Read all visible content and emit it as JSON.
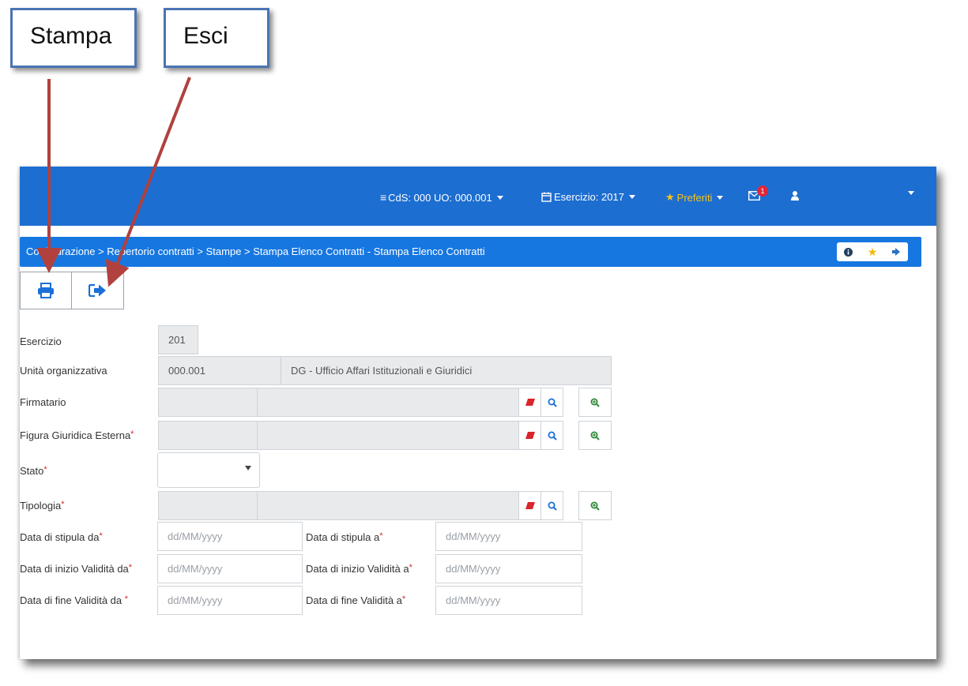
{
  "callouts": {
    "stampa": "Stampa",
    "esci": "Esci"
  },
  "topbar": {
    "cds": "CdS: 000 UO: 000.001",
    "esercizio": "Esercizio: 2017",
    "preferiti": "Preferiti",
    "mail_badge": "1"
  },
  "breadcrumb": "Configurazione > Repertorio contratti > Stampe > Stampa Elenco Contratti - Stampa Elenco Contratti",
  "form": {
    "esercizio": {
      "label": "Esercizio",
      "value": "201"
    },
    "unita": {
      "label": "Unità organizzativa",
      "code": "000.001",
      "description": "DG - Ufficio Affari Istituzionali e Giuridici"
    },
    "firmatario": {
      "label": "Firmatario"
    },
    "figura": {
      "label": "Figura Giuridica Esterna"
    },
    "stato": {
      "label": "Stato"
    },
    "tipologia": {
      "label": "Tipologia"
    },
    "stipula_da": {
      "label": "Data di stipula da",
      "placeholder": "dd/MM/yyyy"
    },
    "stipula_a": {
      "label": "Data di stipula a",
      "placeholder": "dd/MM/yyyy"
    },
    "inizio_da": {
      "label": "Data di inizio Validità da",
      "placeholder": "dd/MM/yyyy"
    },
    "inizio_a": {
      "label": "Data di inizio Validità a",
      "placeholder": "dd/MM/yyyy"
    },
    "fine_da": {
      "label": "Data di fine Validità da ",
      "placeholder": "dd/MM/yyyy"
    },
    "fine_a": {
      "label": "Data di fine Validità a",
      "placeholder": "dd/MM/yyyy"
    },
    "required_mark": "*"
  },
  "colors": {
    "topbar": "#1d6ed1",
    "breadcrumb": "#1777e0",
    "print_icon": "#1a6fd8",
    "annotation": "#b0413e"
  }
}
